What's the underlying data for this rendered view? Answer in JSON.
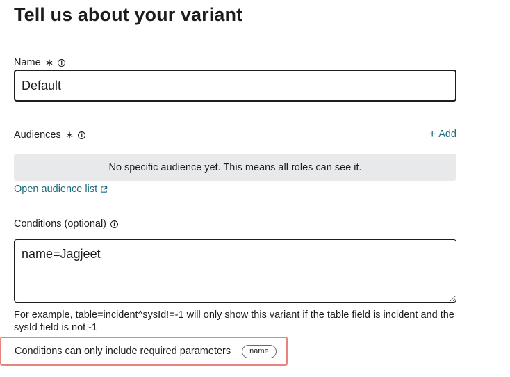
{
  "page": {
    "title": "Tell us about your variant"
  },
  "name_field": {
    "label": "Name",
    "required_mark": "∗",
    "value": "Default"
  },
  "audiences": {
    "label": "Audiences",
    "required_mark": "∗",
    "add_label": "Add",
    "empty_message": "No specific audience yet. This means all roles can see it.",
    "open_list_label": "Open audience list"
  },
  "conditions": {
    "label": "Conditions (optional)",
    "value": "name=Jagjeet",
    "helper": "For example, table=incident^sysId!=-1 will only show this variant if the table field is incident and the sysId field is not -1",
    "note": "Conditions can only include required parameters",
    "param_tag": "name"
  },
  "colors": {
    "link": "#1a6b7c",
    "highlight_border": "#e8847f",
    "empty_bg": "#e7e9eb"
  }
}
